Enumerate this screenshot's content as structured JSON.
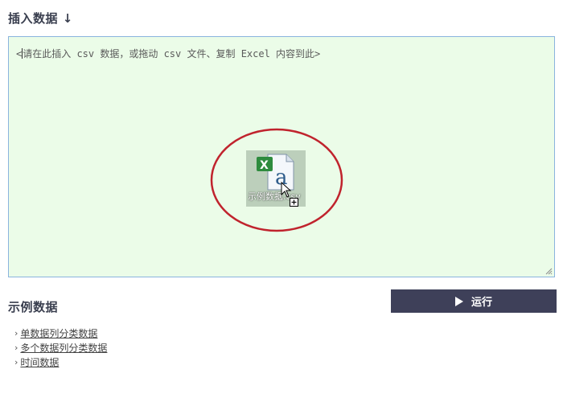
{
  "insert_section": {
    "title": "插入数据 ↓",
    "placeholder": "请在此插入 csv 数据，或拖动 csv 文件、复制 Excel 内容到此>",
    "placeholder_prefix": "<"
  },
  "drag_ghost": {
    "file_label": "示例数据.csv",
    "icon": "excel-csv-file-icon",
    "cursor": "copy-cursor-icon"
  },
  "run_button": {
    "label": "运行",
    "icon": "play-icon",
    "bg_color": "#3e4059"
  },
  "examples_section": {
    "title": "示例数据",
    "items": [
      {
        "label": "单数据列分类数据"
      },
      {
        "label": "多个数据列分类数据"
      },
      {
        "label": "时间数据"
      }
    ]
  },
  "colors": {
    "textarea_bg": "#ebfce8",
    "textarea_border": "#8ab4de",
    "highlight_circle": "#c0232d"
  }
}
